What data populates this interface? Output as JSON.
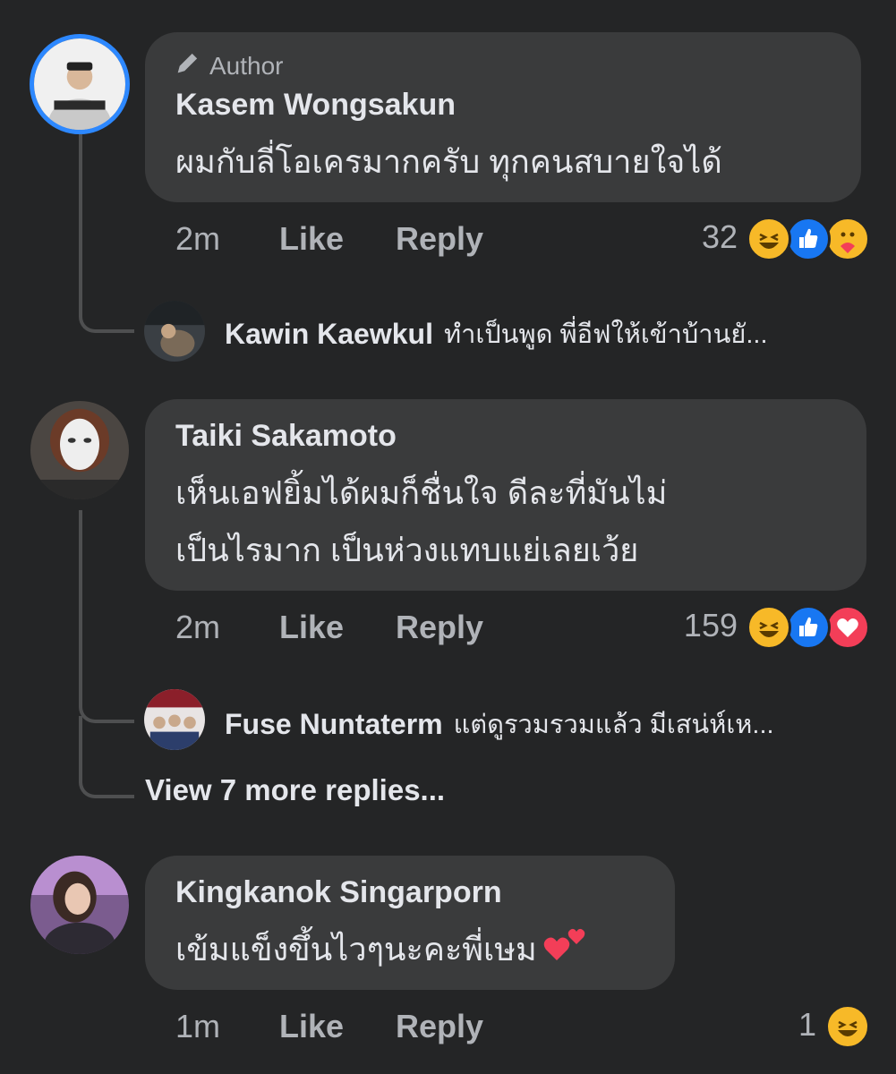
{
  "comments": [
    {
      "author_tag": "Author",
      "name": "Kasem Wongsakun",
      "text_lines": [
        "ผมกับลี่โอเครมากครับ ทุกคนสบายใจได้"
      ],
      "time": "2m",
      "like_label": "Like",
      "reply_label": "Reply",
      "reaction_count": "32",
      "reactions": [
        "haha-icon",
        "like-icon",
        "care-icon"
      ],
      "reply_preview": {
        "name": "Kawin Kaewkul",
        "text": "ทำเป็นพูด พี่อีฟให้เข้าบ้านยั..."
      }
    },
    {
      "name": "Taiki Sakamoto",
      "text_lines": [
        "เห็นเอฟยิ้มได้ผมก็ชื่นใจ ดีละที่มันไม่",
        "เป็นไรมาก เป็นห่วงแทบแย่เลยเว้ย"
      ],
      "time": "2m",
      "like_label": "Like",
      "reply_label": "Reply",
      "reaction_count": "159",
      "reactions": [
        "haha-icon",
        "like-icon",
        "love-icon"
      ],
      "reply_preview": {
        "name": "Fuse Nuntaterm",
        "text": "แต่ดูรวมรวมแล้ว มีเสน่ห์เห..."
      },
      "view_more": "View 7 more replies..."
    },
    {
      "name": "Kingkanok Singarporn",
      "text_lines": [
        "เข้มแข็งขึ้นไวๆนะคะพี่เษม"
      ],
      "time": "1m",
      "like_label": "Like",
      "reply_label": "Reply",
      "reaction_count": "1",
      "reactions": [
        "haha-icon"
      ]
    }
  ],
  "colors": {
    "background": "#242526",
    "bubble": "#3a3b3c",
    "secondary_text": "#b0b3b8",
    "author_ring": "#2d88ff",
    "like_blue": "#1877f2",
    "love_red": "#f33e58",
    "haha_yellow": "#f7b928"
  }
}
